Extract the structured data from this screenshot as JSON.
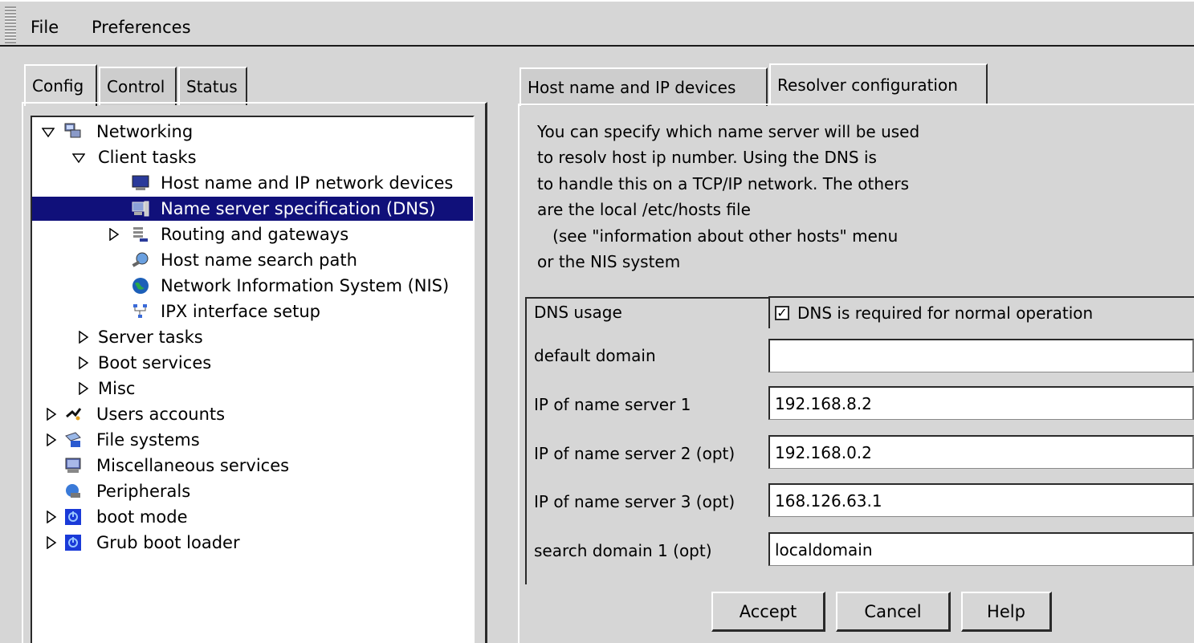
{
  "menubar": {
    "file": "File",
    "preferences": "Preferences"
  },
  "left_tabs": {
    "config": "Config",
    "control": "Control",
    "status": "Status"
  },
  "tree": {
    "networking": "Networking",
    "client_tasks": "Client tasks",
    "host_name_ip": "Host name and IP network devices",
    "name_server": "Name server specification (DNS)",
    "routing": "Routing and gateways",
    "host_search": "Host name search path",
    "nis": "Network Information System (NIS)",
    "ipx": "IPX interface setup",
    "server_tasks": "Server tasks",
    "boot_services": "Boot services",
    "misc": "Misc",
    "users_accounts": "Users accounts",
    "file_systems": "File systems",
    "misc_services": "Miscellaneous services",
    "peripherals": "Peripherals",
    "boot_mode": "boot mode",
    "grub": "Grub boot loader"
  },
  "right_tabs": {
    "host_name": "Host name and IP devices",
    "resolver": "Resolver configuration"
  },
  "description": {
    "line1": "You can specify which name server will be used",
    "line2": "to resolv host ip number. Using the DNS is",
    "line3": "to handle this on a TCP/IP network. The others",
    "line4": "are the local /etc/hosts file",
    "line5": "   (see \"information about other hosts\" menu",
    "line6": "or the NIS system"
  },
  "form": {
    "dns_usage_label": "DNS usage",
    "dns_required_label": "DNS is required for normal operation",
    "dns_required_checked": true,
    "default_domain_label": "default domain",
    "default_domain_value": "",
    "ns1_label": "IP of name server 1",
    "ns1_value": "192.168.8.2",
    "ns2_label": "IP of name server 2 (opt)",
    "ns2_value": "192.168.0.2",
    "ns3_label": "IP of name server 3 (opt)",
    "ns3_value": "168.126.63.1",
    "search1_label": "search domain 1 (opt)",
    "search1_value": "localdomain"
  },
  "buttons": {
    "accept": "Accept",
    "cancel": "Cancel",
    "help": "Help"
  },
  "colors": {
    "selection": "#10107a",
    "background": "#d6d6d6"
  }
}
